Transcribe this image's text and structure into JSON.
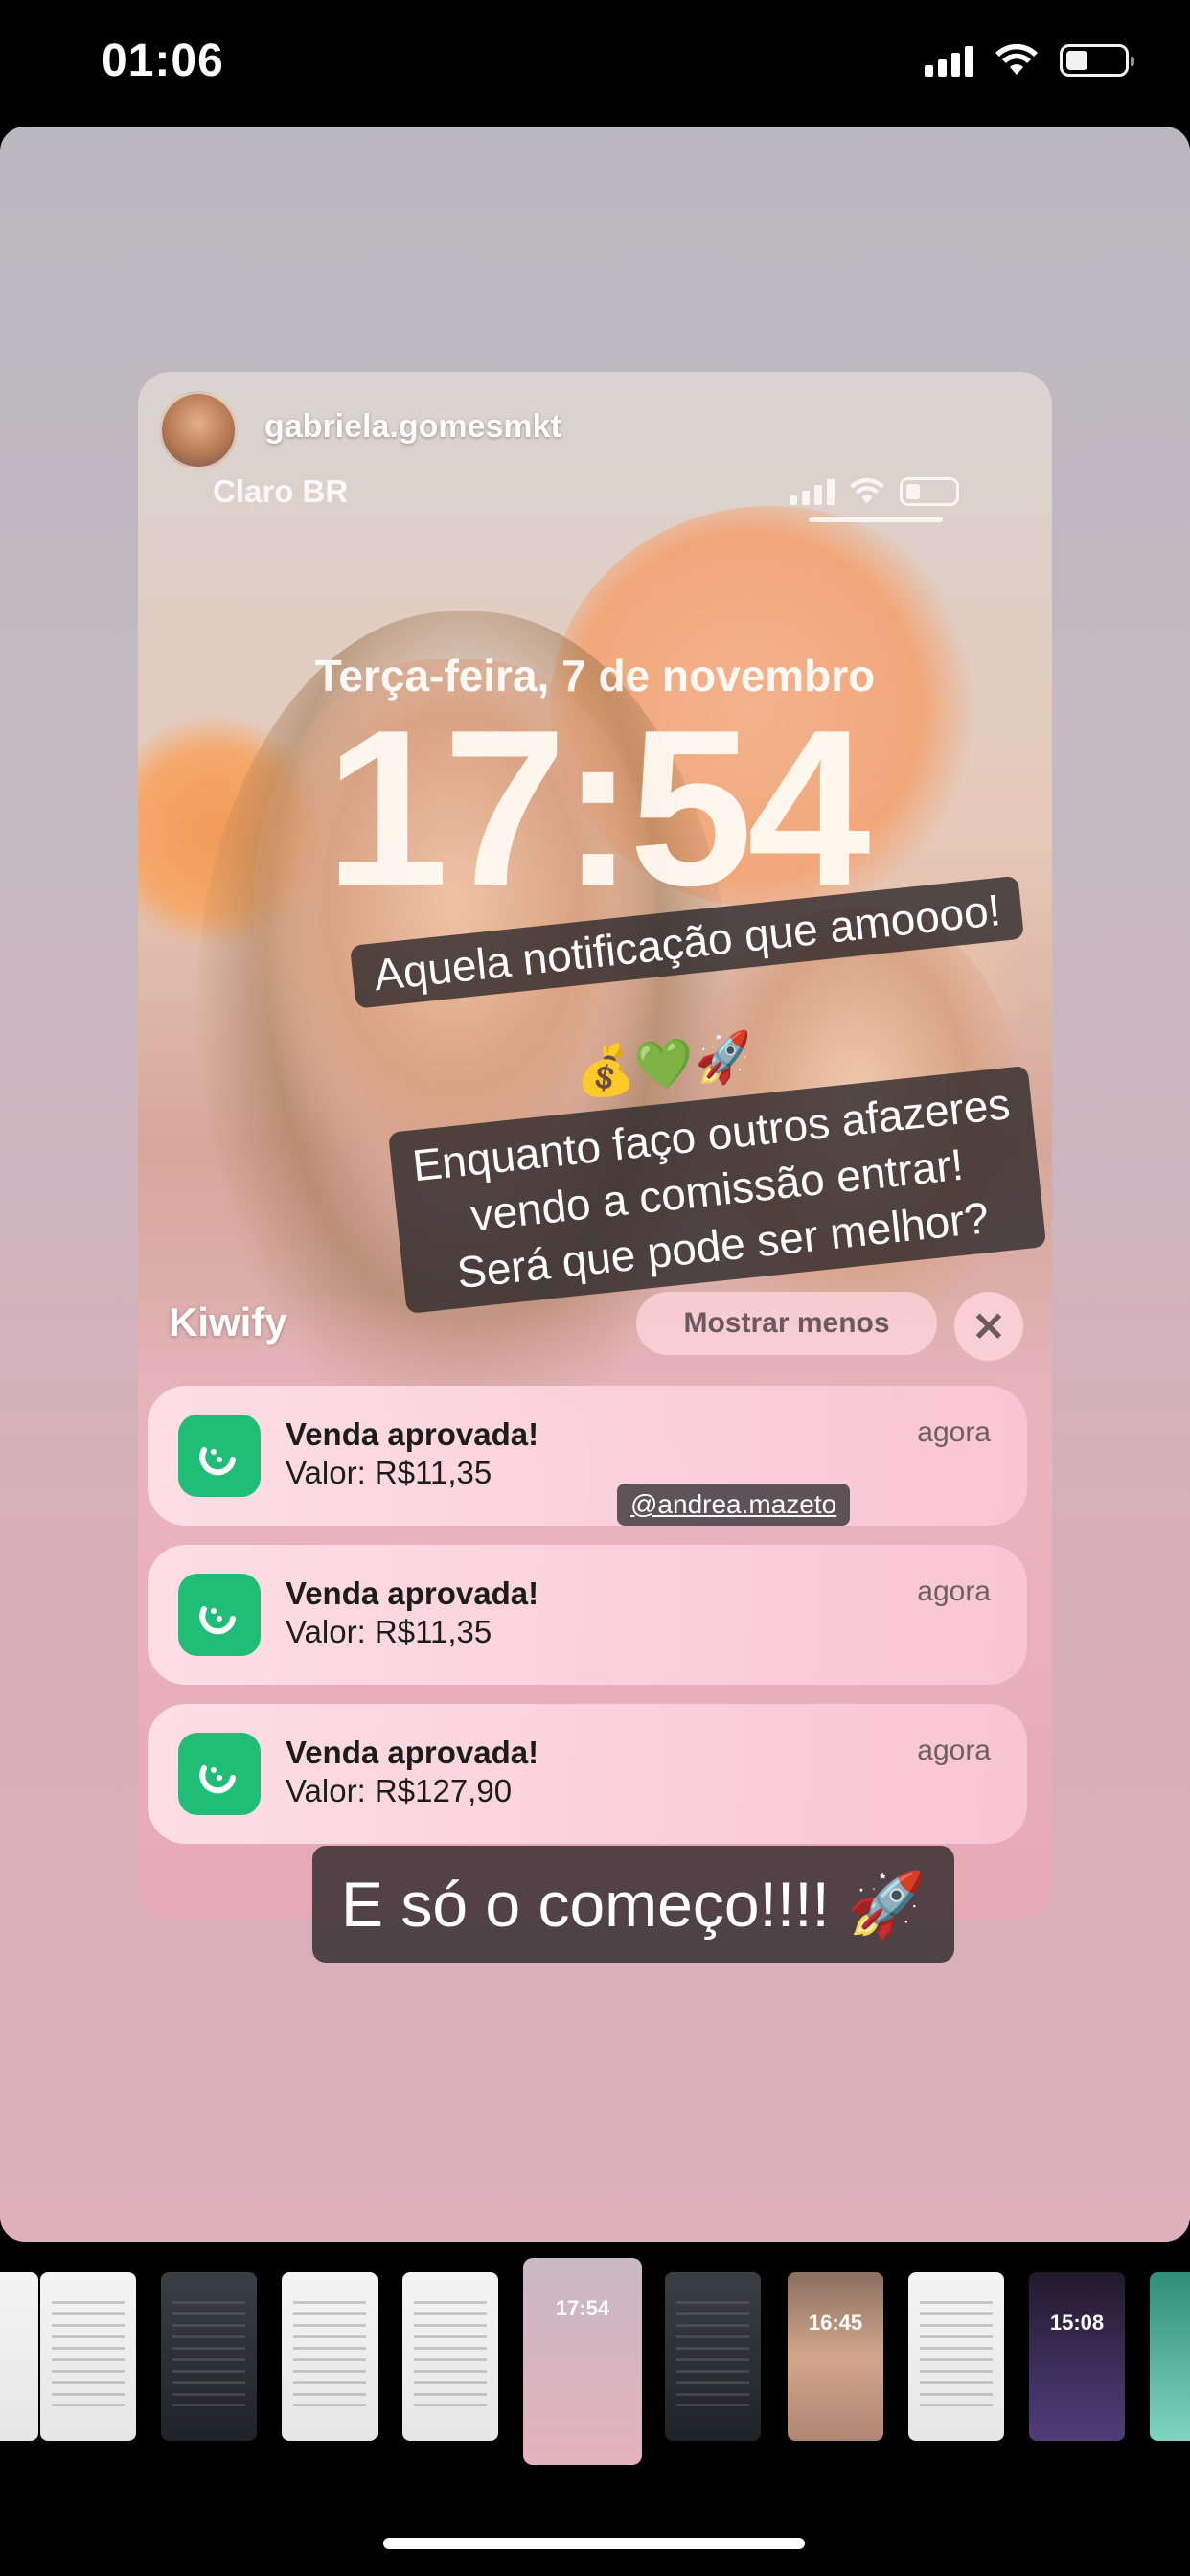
{
  "status_bar": {
    "time": "01:06",
    "icons": [
      "cellular-signal-icon",
      "wifi-icon",
      "battery-icon"
    ]
  },
  "story": {
    "screenshot": {
      "username": "gabriela.gomesmkt",
      "carrier": "Claro BR",
      "lock_date": "Terça-feira, 7 de novembro",
      "lock_time": "17:54",
      "group_app": "Kiwify",
      "show_less": "Mostrar menos",
      "close_glyph": "✕",
      "notifications": [
        {
          "title": "Venda aprovada!",
          "body": "Valor: R$11,35",
          "time": "agora"
        },
        {
          "title": "Venda aprovada!",
          "body": "Valor: R$11,35",
          "time": "agora"
        },
        {
          "title": "Venda aprovada!",
          "body": "Valor: R$127,90",
          "time": "agora"
        }
      ],
      "mention": "@andrea.mazeto"
    },
    "captions": {
      "line1": "Aquela notificação que amoooo!",
      "line1_emojis": "💰💚🚀",
      "line2_a": "Enquanto faço outros afazeres",
      "line2_b": "vendo a comissão entrar!",
      "line2_c": "Será que pode ser melhor?",
      "bottom": "E só o começo!!!! 🚀"
    }
  },
  "thumbnails": [
    {
      "style": "white",
      "text": ""
    },
    {
      "style": "dark",
      "text": ""
    },
    {
      "style": "white",
      "text": ""
    },
    {
      "style": "white",
      "text": ""
    },
    {
      "style": "pink",
      "text": "17:54",
      "active": true
    },
    {
      "style": "dark",
      "text": ""
    },
    {
      "style": "photo",
      "text": "16:45"
    },
    {
      "style": "white",
      "text": ""
    },
    {
      "style": "purple",
      "text": "15:08"
    },
    {
      "style": "teal",
      "text": ""
    }
  ]
}
